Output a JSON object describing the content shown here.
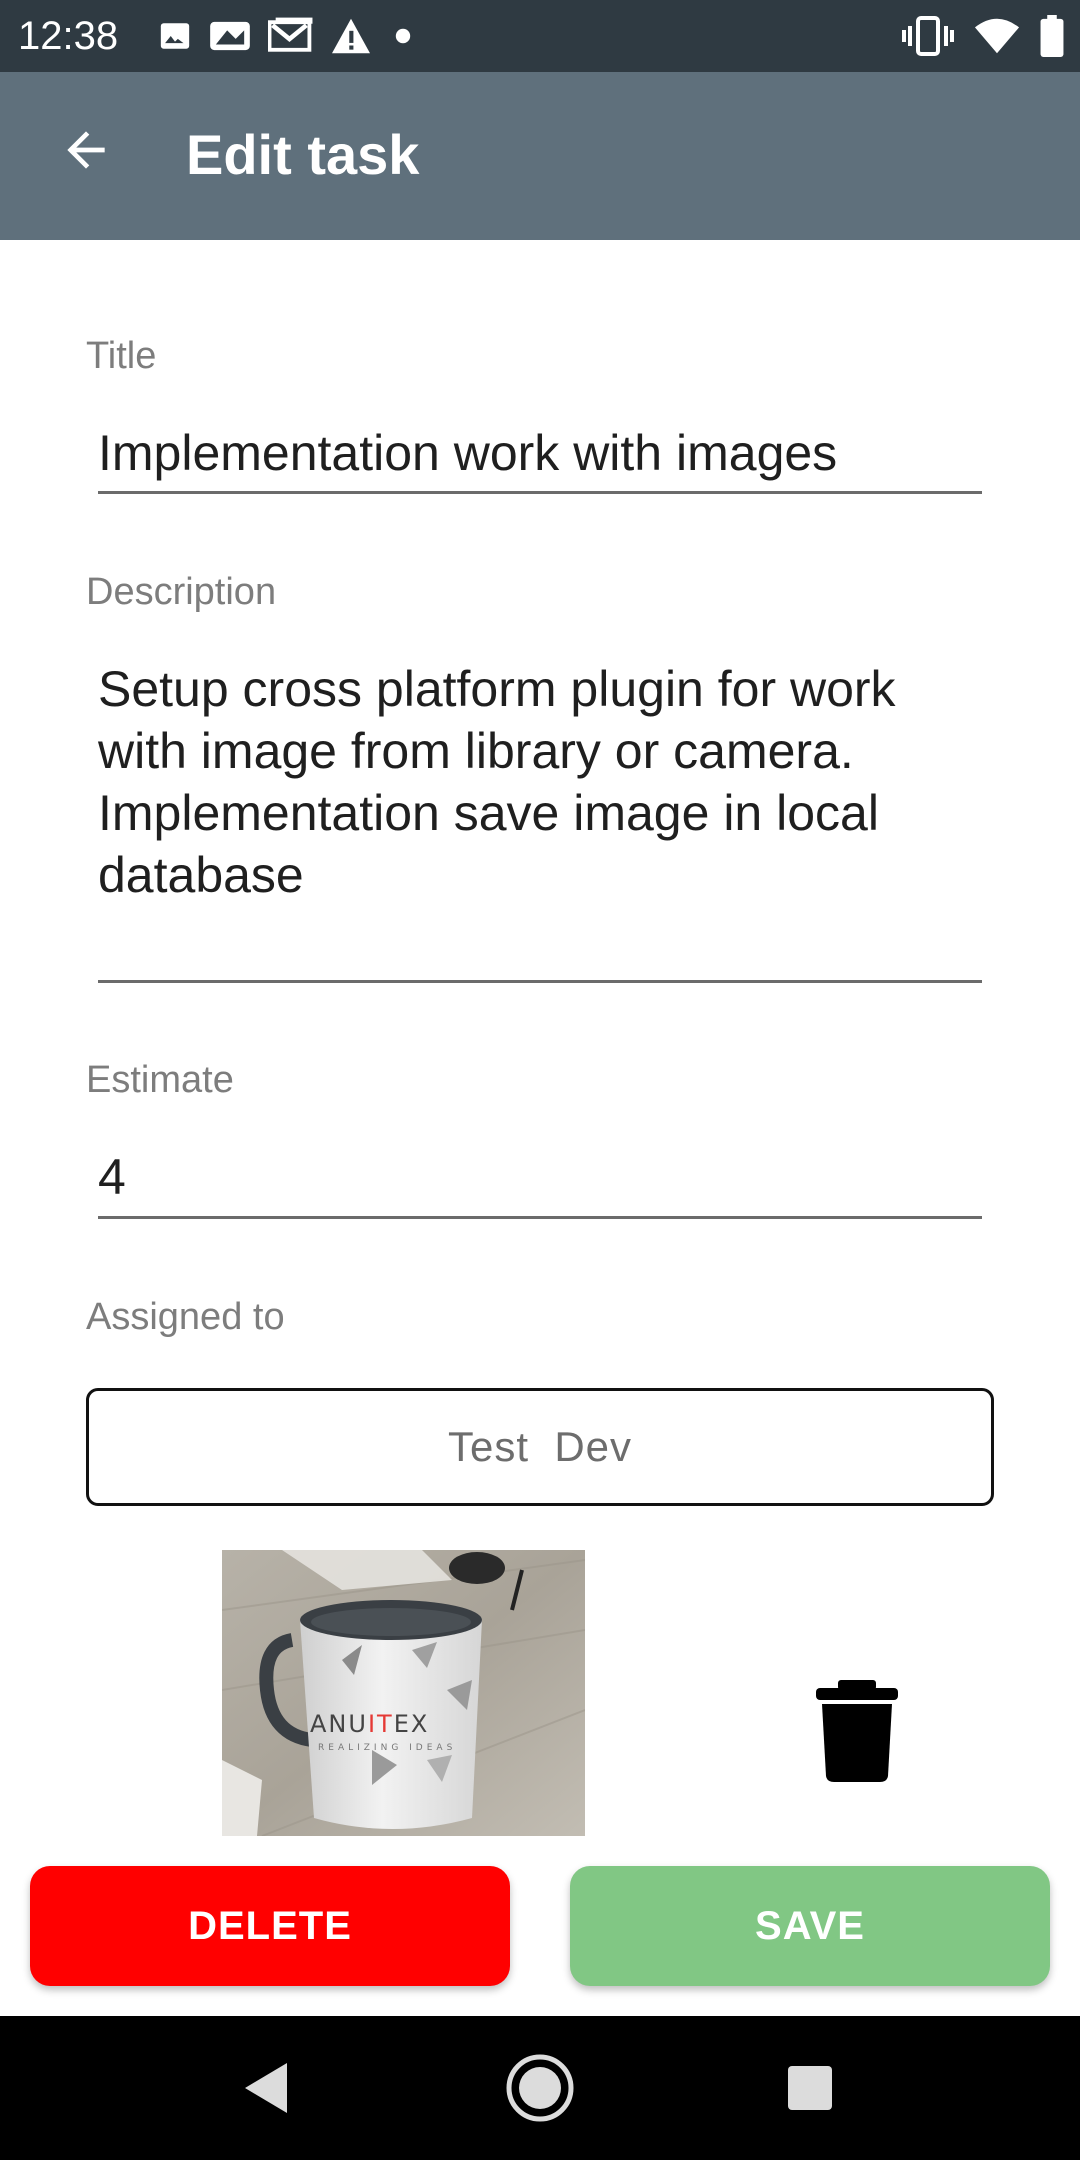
{
  "status_bar": {
    "time": "12:38",
    "left_icons": [
      "image-icon",
      "photo-sim-icon",
      "gmail-icon",
      "warning-icon",
      "dot-icon"
    ],
    "right_icons": [
      "vibrate-icon",
      "wifi-icon",
      "battery-icon"
    ]
  },
  "app_bar": {
    "back_icon": "arrow-back-icon",
    "title": "Edit task"
  },
  "form": {
    "title_label": "Title",
    "title_value": "Implementation work with images",
    "description_label": "Description",
    "description_value": "Setup cross platform plugin for work with image from library or camera. Implementation save image in local database",
    "estimate_label": "Estimate",
    "estimate_value": "4",
    "assigned_label": "Assigned to",
    "assigned_value": "Test  Dev"
  },
  "attachment": {
    "image_subject": "mug",
    "mug_text": "ANUITEX",
    "delete_icon": "trash-icon"
  },
  "actions": {
    "delete_label": "DELETE",
    "save_label": "SAVE"
  },
  "colors": {
    "status_bar": "#2f3a42",
    "app_bar": "#5f707c",
    "delete": "#ff0000",
    "save": "#81c784"
  },
  "nav_bar": {
    "icons": [
      "nav-back-icon",
      "nav-home-icon",
      "nav-recents-icon"
    ]
  }
}
